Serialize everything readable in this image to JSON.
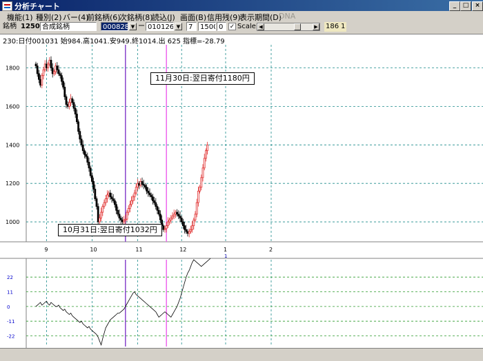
{
  "window": {
    "title": "分析チャート",
    "btn_min": "_",
    "btn_max": "□",
    "btn_close": "×"
  },
  "menu": [
    {
      "label": "機能(1)",
      "disabled": false
    },
    {
      "label": "種別(2)",
      "disabled": false
    },
    {
      "label": "バー(4)",
      "disabled": false
    },
    {
      "label": "前銘柄(6)",
      "disabled": false
    },
    {
      "label": "次銘柄(8)",
      "disabled": false
    },
    {
      "label": "読込(J)",
      "disabled": false
    },
    {
      "label": "画面(B)",
      "disabled": false
    },
    {
      "label": "信用残(9)",
      "disabled": false
    },
    {
      "label": "表示期間(D)",
      "disabled": false
    },
    {
      "label": "DNA",
      "disabled": true
    }
  ],
  "toolbar": {
    "code_label": "銘柄",
    "code": "1250",
    "name": "合成銘柄",
    "date_from": "000828",
    "dash": "ー",
    "date_to": "010126",
    "period": "7",
    "range_max": "1500",
    "range_min": "0",
    "scale_checked": "✓",
    "scale_label": "Scale",
    "scroll_left": "◀",
    "scroll_right": "▶",
    "count": "186",
    "step": "1"
  },
  "infobar": {
    "text": "230:日付001031 始984.高1041.安949.終1014.出 625 指標=-28.79"
  },
  "annotations": {
    "top": "11月30日:翌日寄付1180円",
    "bottom": "10月31日:翌日寄付1032円"
  },
  "colors": {
    "up": "#e03030",
    "down": "#000000",
    "grid": "#1a8a8a",
    "marker_nov": "#ee66ee",
    "marker_oct": "#8844cc"
  },
  "chart_data": [
    {
      "type": "candlestick",
      "ylim": [
        900,
        1920
      ],
      "yticks": [
        1000,
        1200,
        1400,
        1600,
        1800
      ],
      "xticks": [
        {
          "label": "9",
          "i": 7
        },
        {
          "label": "10",
          "i": 37
        },
        {
          "label": "11",
          "i": 67
        },
        {
          "label": "12",
          "i": 96
        },
        {
          "label": "1",
          "i": 125
        },
        {
          "label": "2",
          "i": 155
        }
      ],
      "year_marker": {
        "label": "1",
        "i": 125
      },
      "markers": [
        {
          "i": 59,
          "color": "#8844cc"
        },
        {
          "i": 86,
          "color": "#ee66ee"
        }
      ],
      "closes": [
        1810,
        1770,
        1740,
        1710,
        1760,
        1790,
        1820,
        1800,
        1820,
        1840,
        1800,
        1770,
        1780,
        1810,
        1790,
        1770,
        1760,
        1730,
        1700,
        1650,
        1610,
        1600,
        1620,
        1640,
        1620,
        1590,
        1560,
        1520,
        1470,
        1430,
        1400,
        1370,
        1350,
        1340,
        1310,
        1280,
        1240,
        1210,
        1170,
        1120,
        1080,
        1000,
        1020,
        1050,
        1080,
        1100,
        1120,
        1140,
        1150,
        1130,
        1120,
        1110,
        1090,
        1060,
        1040,
        1020,
        1010,
        1000,
        1010,
        1014,
        1050,
        1070,
        1090,
        1110,
        1130,
        1150,
        1180,
        1200,
        1190,
        1210,
        1195,
        1190,
        1180,
        1160,
        1150,
        1140,
        1130,
        1110,
        1100,
        1080,
        1060,
        1040,
        1010,
        980,
        960,
        965,
        980,
        1000,
        1010,
        1020,
        1030,
        1040,
        1050,
        1040,
        1030,
        1020,
        1000,
        980,
        960,
        950,
        940,
        950,
        960,
        980,
        1010,
        1040,
        1100,
        1160,
        1180,
        1230,
        1280,
        1330,
        1370,
        1400
      ]
    },
    {
      "type": "line",
      "name": "",
      "ylim": [
        -30,
        35
      ],
      "yticks": [
        22,
        11,
        0,
        -11,
        -22
      ],
      "values": [
        0,
        1,
        2,
        3,
        1,
        2,
        3,
        4,
        2,
        1,
        3,
        2,
        1,
        0,
        0,
        1,
        -1,
        -2,
        -3,
        -2,
        -4,
        -5,
        -6,
        -5,
        -7,
        -8,
        -9,
        -10,
        -11,
        -12,
        -11,
        -13,
        -14,
        -15,
        -16,
        -15,
        -17,
        -18,
        -19,
        -20,
        -21,
        -23,
        -26,
        -28.79,
        -24,
        -20,
        -16,
        -14,
        -12,
        -10,
        -9,
        -8,
        -7,
        -6,
        -5,
        -5,
        -4,
        -3,
        -2,
        0,
        2,
        4,
        6,
        8,
        10,
        11,
        9,
        8,
        7,
        6,
        5,
        4,
        3,
        2,
        1,
        0,
        -1,
        -2,
        -3,
        -4,
        -6,
        -8,
        -7,
        -6,
        -5,
        -4,
        -5,
        -6,
        -7,
        -8,
        -6,
        -4,
        -2,
        0,
        3,
        6,
        10,
        14,
        18,
        22,
        25,
        27,
        30,
        33,
        35,
        34,
        33,
        32,
        31,
        30,
        31,
        32,
        33,
        34,
        35,
        36
      ]
    }
  ]
}
